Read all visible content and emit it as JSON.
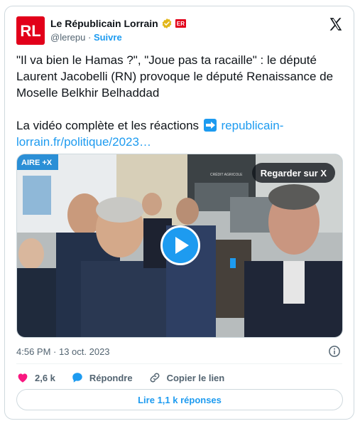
{
  "author": {
    "logo_text": "RL",
    "name": "Le Républicain Lorrain",
    "badge": "ER",
    "handle": "@lerepu",
    "separator": "·",
    "follow_label": "Suivre"
  },
  "tweet": {
    "line1": "\"Il va bien le Hamas ?\", \"Joue pas ta racaille\" : le député Laurent Jacobelli (RN) provoque le député Renaissance de Moselle Belkhir Belhaddad",
    "line2_prefix": "La vidéo complète et les réactions",
    "link_text": "republicain-lorrain.fr/politique/2023…"
  },
  "media": {
    "watch_label": "Regarder sur X",
    "sign_left": "AIRE +X",
    "sign_bank": "CRÉDIT AGRICOLE"
  },
  "meta": {
    "timestamp": "4:56 PM · 13 oct. 2023"
  },
  "actions": {
    "likes": "2,6 k",
    "reply_label": "Répondre",
    "copy_label": "Copier le lien"
  },
  "replies_button": "Lire 1,1 k réponses",
  "colors": {
    "brand_red": "#e2001a",
    "accent_blue": "#1d9bf0",
    "like_pink": "#f91880",
    "muted": "#536471"
  }
}
